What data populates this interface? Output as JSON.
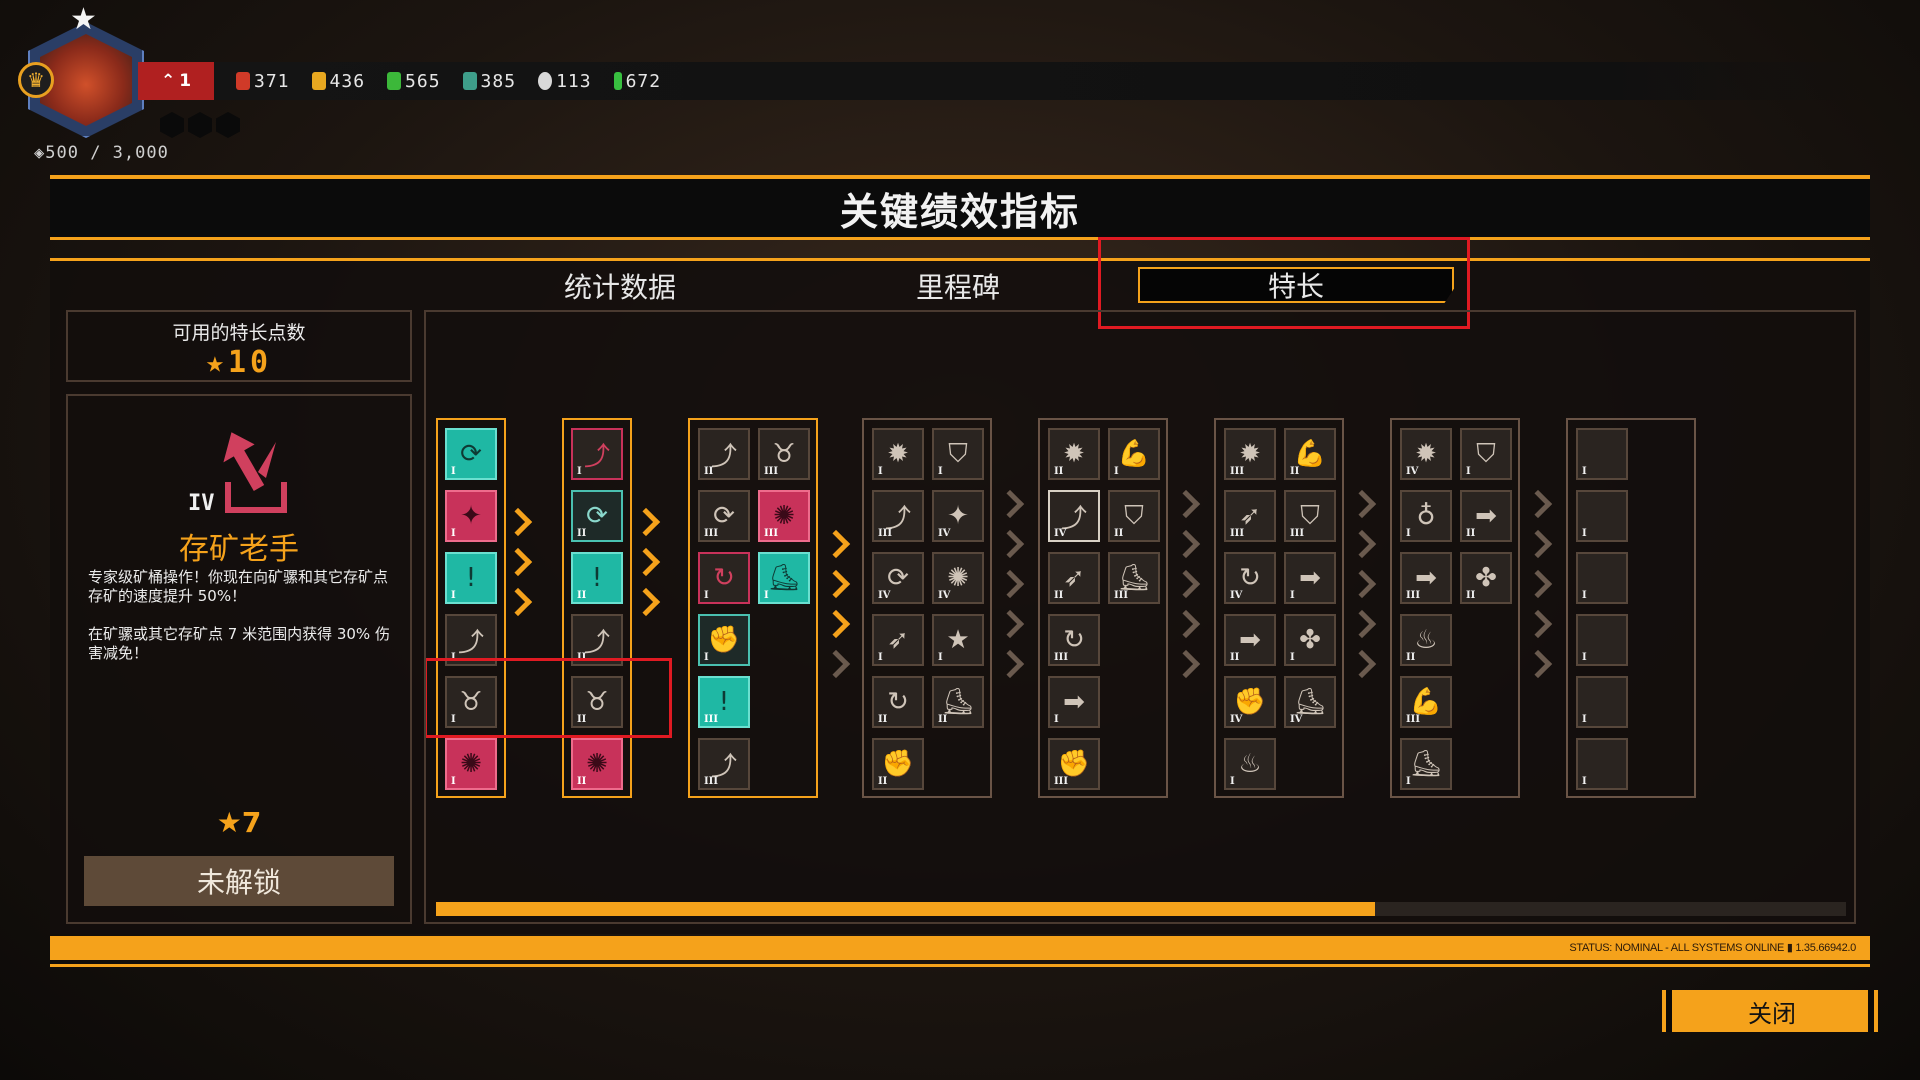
{
  "player": {
    "rank": "1",
    "xp": "500 / 3,000"
  },
  "resources": [
    {
      "name": "ember",
      "value": "371",
      "color": "#d03a28"
    },
    {
      "name": "gold",
      "value": "436",
      "color": "#e8a820"
    },
    {
      "name": "green-crystal",
      "value": "565",
      "color": "#3cb83a"
    },
    {
      "name": "teal-crystal",
      "value": "385",
      "color": "#3e9e8a"
    },
    {
      "name": "silver",
      "value": "113",
      "color": "#d8d8d8"
    },
    {
      "name": "bio",
      "value": "672",
      "color": "#38c040"
    }
  ],
  "title": "关键绩效指标",
  "tabs": {
    "stats": "统计数据",
    "milestones": "里程碑",
    "perks": "特长"
  },
  "points": {
    "label": "可用的特长点数",
    "value": "10"
  },
  "detail": {
    "tier": "IV",
    "name": "存矿老手",
    "desc": "专家级矿桶操作！你现在向矿骡和其它存矿点存矿的速度提升 50%！\n\n在矿骡或其它存矿点 7 米范围内获得 30% 伤害减免！",
    "cost": "7",
    "unlock_label": "未解锁"
  },
  "progress": {
    "fraction": 0.666
  },
  "status_text": "STATUS: NOMINAL - ALL SYSTEMS ONLINE ▮ 1.35.66942.0",
  "close_label": "关闭",
  "accent": "#f5a21b",
  "highlight_red": "#e01a22"
}
